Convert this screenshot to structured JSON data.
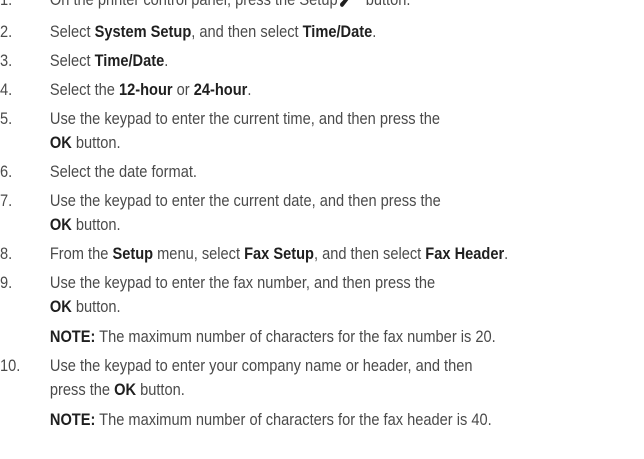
{
  "steps": [
    {
      "num": "1.",
      "parts": [
        {
          "text": "On the printer control panel, press the Setup",
          "bold": false
        },
        {
          "icon": "wrench-icon"
        },
        {
          "text": " button.",
          "bold": false
        }
      ]
    },
    {
      "num": "2.",
      "parts": [
        {
          "text": "Select ",
          "bold": false
        },
        {
          "text": "System Setup",
          "bold": true
        },
        {
          "text": ", and then select ",
          "bold": false
        },
        {
          "text": "Time/Date",
          "bold": true
        },
        {
          "text": ".",
          "bold": false
        }
      ]
    },
    {
      "num": "3.",
      "parts": [
        {
          "text": "Select ",
          "bold": false
        },
        {
          "text": "Time/Date",
          "bold": true
        },
        {
          "text": ".",
          "bold": false
        }
      ]
    },
    {
      "num": "4.",
      "parts": [
        {
          "text": "Select the ",
          "bold": false
        },
        {
          "text": "12-hour",
          "bold": true
        },
        {
          "text": " or ",
          "bold": false
        },
        {
          "text": "24-hour",
          "bold": true
        },
        {
          "text": ".",
          "bold": false
        }
      ]
    },
    {
      "num": "5.",
      "parts": [
        {
          "text": "Use the keypad to enter the current time, and then press the",
          "bold": false
        },
        {
          "br": true
        },
        {
          "text": "OK",
          "bold": true
        },
        {
          "text": " button.",
          "bold": false
        }
      ]
    },
    {
      "num": "6.",
      "parts": [
        {
          "text": "Select the date format.",
          "bold": false
        }
      ]
    },
    {
      "num": "7.",
      "parts": [
        {
          "text": "Use the keypad to enter the current date, and then press the",
          "bold": false
        },
        {
          "br": true
        },
        {
          "text": "OK",
          "bold": true
        },
        {
          "text": " button.",
          "bold": false
        }
      ]
    },
    {
      "num": "8.",
      "parts": [
        {
          "text": "From the ",
          "bold": false
        },
        {
          "text": "Setup",
          "bold": true
        },
        {
          "text": " menu, select ",
          "bold": false
        },
        {
          "text": "Fax Setup",
          "bold": true
        },
        {
          "text": ", and then select ",
          "bold": false
        },
        {
          "text": "Fax Header",
          "bold": true
        },
        {
          "text": ".",
          "bold": false
        }
      ]
    },
    {
      "num": "9.",
      "parts": [
        {
          "text": "Use the keypad to enter the fax number, and then press the",
          "bold": false
        },
        {
          "br": true
        },
        {
          "text": "OK",
          "bold": true
        },
        {
          "text": " button.",
          "bold": false
        }
      ],
      "note": [
        {
          "text": "NOTE:",
          "bold": true
        },
        {
          "text": " The maximum number of characters for the fax number is 20.",
          "bold": false
        }
      ]
    },
    {
      "num": "10.",
      "parts": [
        {
          "text": "Use the keypad to enter your company name or header, and then",
          "bold": false
        },
        {
          "br": true
        },
        {
          "text": "press the ",
          "bold": false
        },
        {
          "text": "OK",
          "bold": true
        },
        {
          "text": " button.",
          "bold": false
        }
      ],
      "note": [
        {
          "text": "NOTE:",
          "bold": true
        },
        {
          "text": " The maximum number of characters for the fax header is 40.",
          "bold": false
        }
      ]
    }
  ]
}
